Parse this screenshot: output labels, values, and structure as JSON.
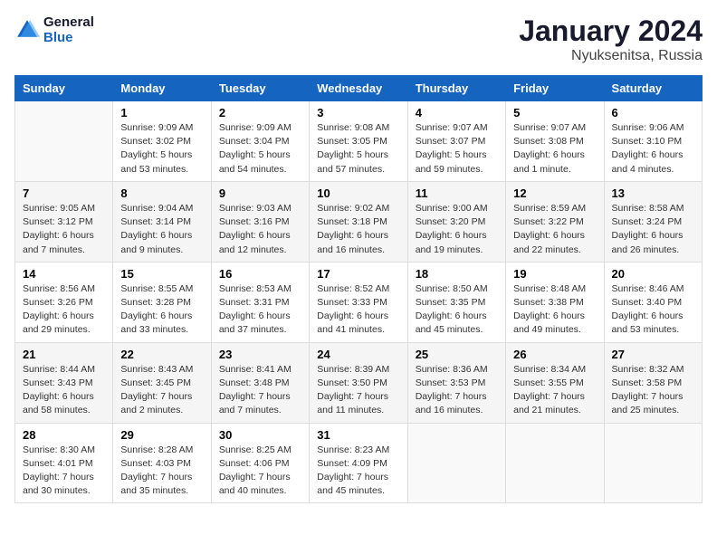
{
  "header": {
    "logo_line1": "General",
    "logo_line2": "Blue",
    "title": "January 2024",
    "subtitle": "Nyuksenitsa, Russia"
  },
  "columns": [
    "Sunday",
    "Monday",
    "Tuesday",
    "Wednesday",
    "Thursday",
    "Friday",
    "Saturday"
  ],
  "weeks": [
    [
      {
        "day": "",
        "info": ""
      },
      {
        "day": "1",
        "info": "Sunrise: 9:09 AM\nSunset: 3:02 PM\nDaylight: 5 hours\nand 53 minutes."
      },
      {
        "day": "2",
        "info": "Sunrise: 9:09 AM\nSunset: 3:04 PM\nDaylight: 5 hours\nand 54 minutes."
      },
      {
        "day": "3",
        "info": "Sunrise: 9:08 AM\nSunset: 3:05 PM\nDaylight: 5 hours\nand 57 minutes."
      },
      {
        "day": "4",
        "info": "Sunrise: 9:07 AM\nSunset: 3:07 PM\nDaylight: 5 hours\nand 59 minutes."
      },
      {
        "day": "5",
        "info": "Sunrise: 9:07 AM\nSunset: 3:08 PM\nDaylight: 6 hours\nand 1 minute."
      },
      {
        "day": "6",
        "info": "Sunrise: 9:06 AM\nSunset: 3:10 PM\nDaylight: 6 hours\nand 4 minutes."
      }
    ],
    [
      {
        "day": "7",
        "info": "Sunrise: 9:05 AM\nSunset: 3:12 PM\nDaylight: 6 hours\nand 7 minutes."
      },
      {
        "day": "8",
        "info": "Sunrise: 9:04 AM\nSunset: 3:14 PM\nDaylight: 6 hours\nand 9 minutes."
      },
      {
        "day": "9",
        "info": "Sunrise: 9:03 AM\nSunset: 3:16 PM\nDaylight: 6 hours\nand 12 minutes."
      },
      {
        "day": "10",
        "info": "Sunrise: 9:02 AM\nSunset: 3:18 PM\nDaylight: 6 hours\nand 16 minutes."
      },
      {
        "day": "11",
        "info": "Sunrise: 9:00 AM\nSunset: 3:20 PM\nDaylight: 6 hours\nand 19 minutes."
      },
      {
        "day": "12",
        "info": "Sunrise: 8:59 AM\nSunset: 3:22 PM\nDaylight: 6 hours\nand 22 minutes."
      },
      {
        "day": "13",
        "info": "Sunrise: 8:58 AM\nSunset: 3:24 PM\nDaylight: 6 hours\nand 26 minutes."
      }
    ],
    [
      {
        "day": "14",
        "info": "Sunrise: 8:56 AM\nSunset: 3:26 PM\nDaylight: 6 hours\nand 29 minutes."
      },
      {
        "day": "15",
        "info": "Sunrise: 8:55 AM\nSunset: 3:28 PM\nDaylight: 6 hours\nand 33 minutes."
      },
      {
        "day": "16",
        "info": "Sunrise: 8:53 AM\nSunset: 3:31 PM\nDaylight: 6 hours\nand 37 minutes."
      },
      {
        "day": "17",
        "info": "Sunrise: 8:52 AM\nSunset: 3:33 PM\nDaylight: 6 hours\nand 41 minutes."
      },
      {
        "day": "18",
        "info": "Sunrise: 8:50 AM\nSunset: 3:35 PM\nDaylight: 6 hours\nand 45 minutes."
      },
      {
        "day": "19",
        "info": "Sunrise: 8:48 AM\nSunset: 3:38 PM\nDaylight: 6 hours\nand 49 minutes."
      },
      {
        "day": "20",
        "info": "Sunrise: 8:46 AM\nSunset: 3:40 PM\nDaylight: 6 hours\nand 53 minutes."
      }
    ],
    [
      {
        "day": "21",
        "info": "Sunrise: 8:44 AM\nSunset: 3:43 PM\nDaylight: 6 hours\nand 58 minutes."
      },
      {
        "day": "22",
        "info": "Sunrise: 8:43 AM\nSunset: 3:45 PM\nDaylight: 7 hours\nand 2 minutes."
      },
      {
        "day": "23",
        "info": "Sunrise: 8:41 AM\nSunset: 3:48 PM\nDaylight: 7 hours\nand 7 minutes."
      },
      {
        "day": "24",
        "info": "Sunrise: 8:39 AM\nSunset: 3:50 PM\nDaylight: 7 hours\nand 11 minutes."
      },
      {
        "day": "25",
        "info": "Sunrise: 8:36 AM\nSunset: 3:53 PM\nDaylight: 7 hours\nand 16 minutes."
      },
      {
        "day": "26",
        "info": "Sunrise: 8:34 AM\nSunset: 3:55 PM\nDaylight: 7 hours\nand 21 minutes."
      },
      {
        "day": "27",
        "info": "Sunrise: 8:32 AM\nSunset: 3:58 PM\nDaylight: 7 hours\nand 25 minutes."
      }
    ],
    [
      {
        "day": "28",
        "info": "Sunrise: 8:30 AM\nSunset: 4:01 PM\nDaylight: 7 hours\nand 30 minutes."
      },
      {
        "day": "29",
        "info": "Sunrise: 8:28 AM\nSunset: 4:03 PM\nDaylight: 7 hours\nand 35 minutes."
      },
      {
        "day": "30",
        "info": "Sunrise: 8:25 AM\nSunset: 4:06 PM\nDaylight: 7 hours\nand 40 minutes."
      },
      {
        "day": "31",
        "info": "Sunrise: 8:23 AM\nSunset: 4:09 PM\nDaylight: 7 hours\nand 45 minutes."
      },
      {
        "day": "",
        "info": ""
      },
      {
        "day": "",
        "info": ""
      },
      {
        "day": "",
        "info": ""
      }
    ]
  ]
}
